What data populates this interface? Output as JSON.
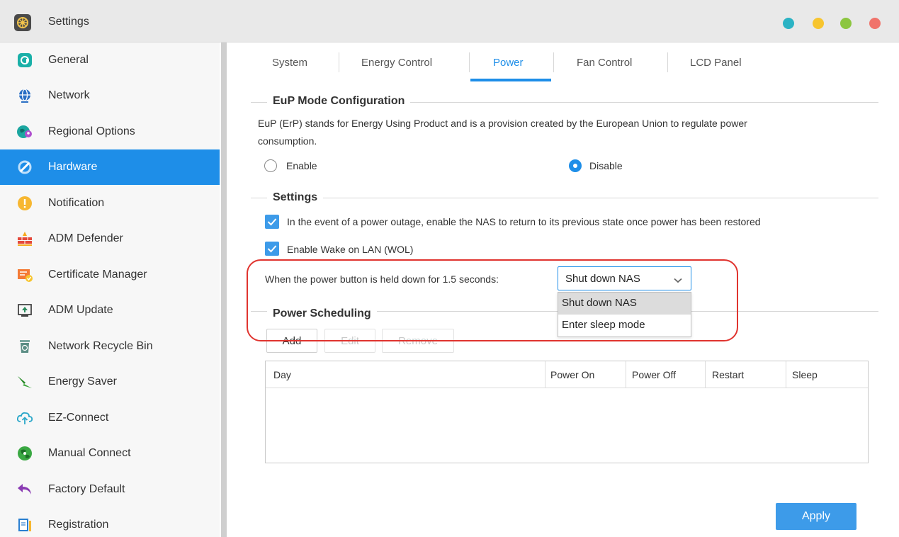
{
  "window": {
    "title": "Settings",
    "icon": "settings-app-icon",
    "controls": [
      {
        "name": "window-button-teal",
        "color": "#2bb3c4"
      },
      {
        "name": "window-button-yellow",
        "color": "#f7c52f"
      },
      {
        "name": "window-button-green",
        "color": "#8cc63f"
      },
      {
        "name": "window-button-red",
        "color": "#f0736b"
      }
    ]
  },
  "sidebar": {
    "active_index": 3,
    "items": [
      {
        "label": "General",
        "icon": "general-icon"
      },
      {
        "label": "Network",
        "icon": "globe-icon"
      },
      {
        "label": "Regional Options",
        "icon": "regional-globe-pin-icon"
      },
      {
        "label": "Hardware",
        "icon": "hardware-icon"
      },
      {
        "label": "Notification",
        "icon": "exclamation-icon"
      },
      {
        "label": "ADM Defender",
        "icon": "firewall-icon"
      },
      {
        "label": "Certificate Manager",
        "icon": "certificate-icon"
      },
      {
        "label": "ADM Update",
        "icon": "update-arrow-icon"
      },
      {
        "label": "Network Recycle Bin",
        "icon": "recycle-bin-icon"
      },
      {
        "label": "Energy Saver",
        "icon": "energy-bolt-icon"
      },
      {
        "label": "EZ-Connect",
        "icon": "cloud-upload-icon"
      },
      {
        "label": "Manual Connect",
        "icon": "network-globe-icon"
      },
      {
        "label": "Factory Default",
        "icon": "undo-arrow-icon"
      },
      {
        "label": "Registration",
        "icon": "registration-icon"
      }
    ]
  },
  "tabs": [
    {
      "label": "System"
    },
    {
      "label": "Energy Control"
    },
    {
      "label": "Power"
    },
    {
      "label": "Fan Control"
    },
    {
      "label": "LCD Panel"
    }
  ],
  "active_tab": "Power",
  "eup": {
    "title": "EuP Mode Configuration",
    "description_line1": "EuP (ErP) stands for Energy Using Product and is a provision created by the European Union to regulate power",
    "description_line2": "consumption.",
    "enable_label": "Enable",
    "disable_label": "Disable",
    "selected": "Disable"
  },
  "settings": {
    "title": "Settings",
    "restore_label": "In the event of a power outage, enable the NAS to return to its previous state once power has been restored",
    "restore_checked": true,
    "wol_label": "Enable Wake on LAN (WOL)",
    "wol_checked": true,
    "power_button_label": "When the power button is held down for 1.5 seconds:",
    "power_button_value": "Shut down NAS",
    "power_button_options": [
      "Shut down NAS",
      "Enter sleep mode"
    ],
    "highlighted_option": "Shut down NAS"
  },
  "scheduling": {
    "title": "Power Scheduling",
    "add_label": "Add",
    "edit_label": "Edit",
    "remove_label": "Remove",
    "columns": [
      "Day",
      "Power On",
      "Power Off",
      "Restart",
      "Sleep"
    ],
    "rows": []
  },
  "apply_label": "Apply",
  "colors": {
    "accent": "#1e8ee8",
    "annotation": "#e0342f",
    "apply": "#3d9be9"
  }
}
